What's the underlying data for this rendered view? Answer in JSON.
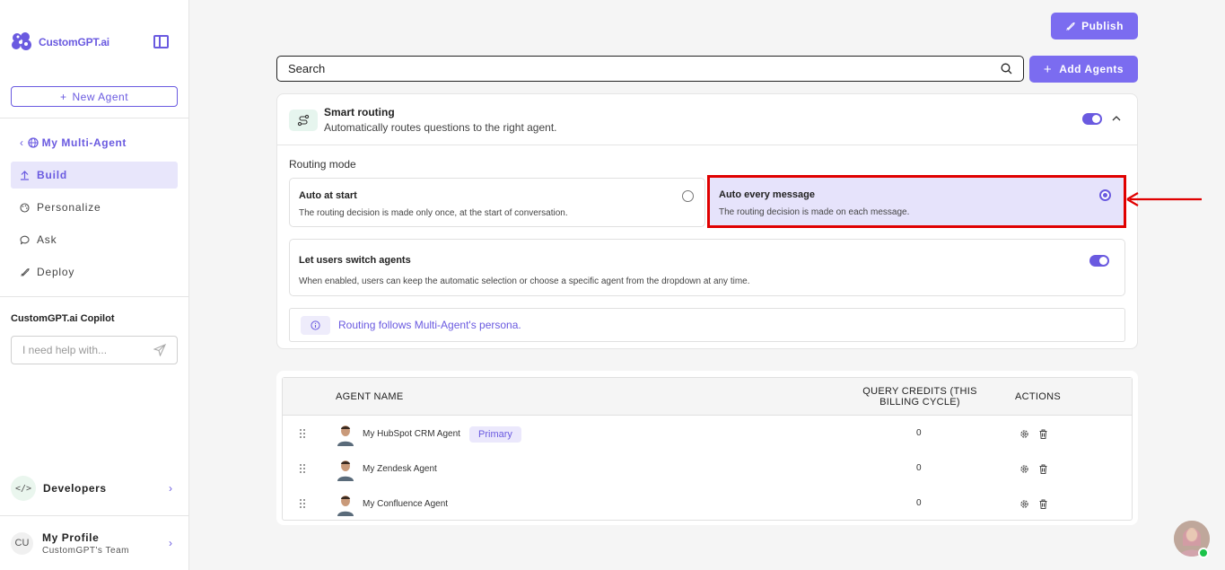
{
  "app": {
    "brand": "CustomGPT.ai",
    "accent": "#6a5ae0"
  },
  "sidebar": {
    "new_agent_label": "New Agent",
    "back_label": "My Multi-Agent",
    "nav": [
      {
        "label": "Build",
        "icon": "upload-icon",
        "active": true
      },
      {
        "label": "Personalize",
        "icon": "palette-icon",
        "active": false
      },
      {
        "label": "Ask",
        "icon": "chat-icon",
        "active": false
      },
      {
        "label": "Deploy",
        "icon": "rocket-icon",
        "active": false
      }
    ],
    "copilot_title": "CustomGPT.ai Copilot",
    "copilot_placeholder": "I need help with...",
    "developers_icon": "</>",
    "developers_label": "Developers",
    "profile_initials": "CU",
    "profile_name": "My Profile",
    "profile_team": "CustomGPT's Team"
  },
  "toolbar": {
    "publish_label": "Publish",
    "search_value": "Search",
    "add_agents_label": "Add Agents"
  },
  "smart_routing": {
    "title": "Smart routing",
    "subtitle": "Automatically routes questions to the right agent.",
    "enabled": true,
    "mode_label": "Routing mode",
    "options": [
      {
        "title": "Auto at start",
        "description": "The routing decision is made only once, at the start of conversation.",
        "selected": false
      },
      {
        "title": "Auto every message",
        "description": "The routing decision is made on each message.",
        "selected": true
      }
    ],
    "switch_title": "Let users switch agents",
    "switch_desc": "When enabled, users can keep the automatic selection or choose a specific agent from the dropdown at any time.",
    "switch_enabled": true,
    "persona_note": "Routing follows Multi-Agent's persona."
  },
  "agents_table": {
    "headers": {
      "name": "AGENT NAME",
      "credits_line1": "QUERY CREDITS (THIS",
      "credits_line2": "BILLING CYCLE)",
      "actions": "ACTIONS"
    },
    "rows": [
      {
        "name": "My HubSpot CRM Agent",
        "badge": "Primary",
        "credits": "0"
      },
      {
        "name": "My Zendesk Agent",
        "badge": "",
        "credits": "0"
      },
      {
        "name": "My Confluence Agent",
        "badge": "",
        "credits": "0"
      }
    ]
  }
}
